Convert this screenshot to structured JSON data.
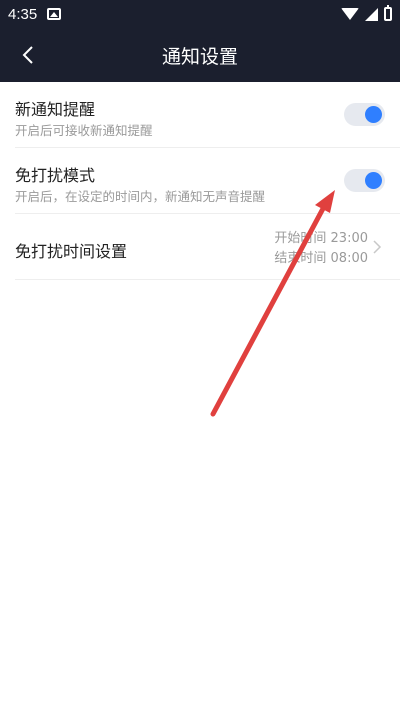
{
  "status_bar": {
    "time": "4:35"
  },
  "header": {
    "title": "通知设置"
  },
  "settings": [
    {
      "title": "新通知提醒",
      "subtitle": "开启后可接收新通知提醒",
      "enabled": true
    },
    {
      "title": "免打扰模式",
      "subtitle": "开启后，在设定的时间内，新通知无声音提醒",
      "enabled": true
    },
    {
      "title": "免打扰时间设置",
      "start_label": "开始时间 23:00",
      "end_label": "结束时间 08:00"
    }
  ],
  "colors": {
    "header_bg": "#1b1f2e",
    "toggle_on": "#2f7fff",
    "annotation_arrow": "#e0403e"
  }
}
